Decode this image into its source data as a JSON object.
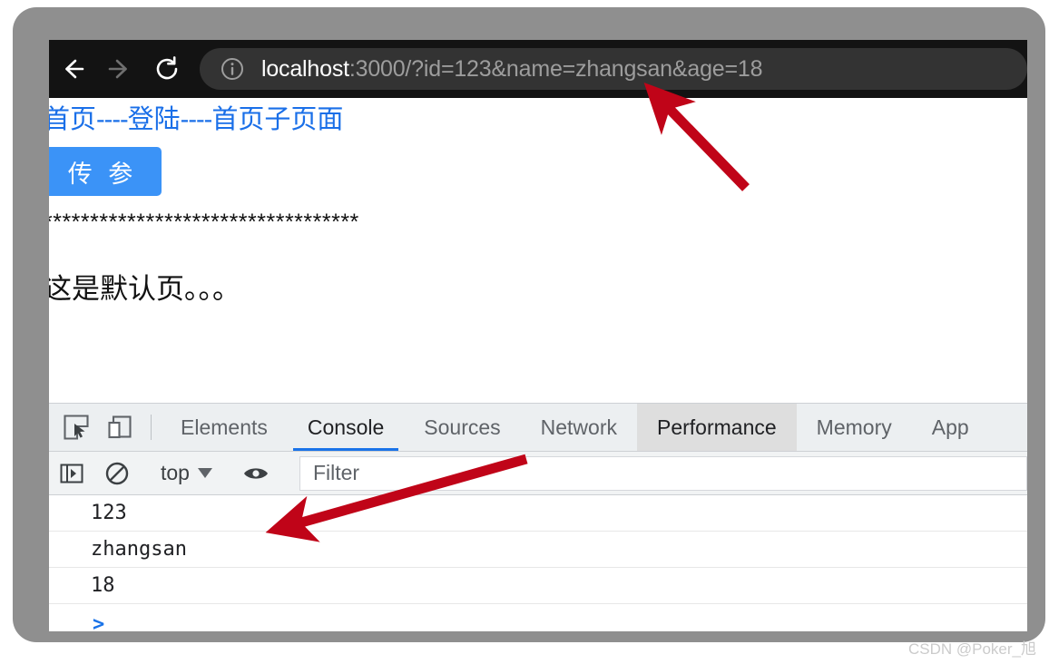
{
  "browser": {
    "back_label": "back-arrow",
    "forward_label": "forward-arrow",
    "reload_label": "reload",
    "url_host": "localhost",
    "url_rest": ":3000/?id=123&name=zhangsan&age=18",
    "url_full": "localhost:3000/?id=123&name=zhangsan&age=18",
    "site_info_icon": "info-circle-icon"
  },
  "page": {
    "links": [
      {
        "label": "首页"
      },
      {
        "label": "登陆"
      },
      {
        "label": "首页子页面"
      }
    ],
    "separator": "----",
    "button_label": "传 参",
    "divider_stars": "**********************************",
    "body_text": "这是默认页。。。"
  },
  "devtools": {
    "inspect_icon": "inspect-element-icon",
    "device_toggle_icon": "device-toolbar-icon",
    "tabs": [
      {
        "label": "Elements",
        "state": "normal"
      },
      {
        "label": "Console",
        "state": "active"
      },
      {
        "label": "Sources",
        "state": "normal"
      },
      {
        "label": "Network",
        "state": "normal"
      },
      {
        "label": "Performance",
        "state": "hovered"
      },
      {
        "label": "Memory",
        "state": "normal"
      },
      {
        "label": "App",
        "state": "clipped"
      }
    ],
    "console_toolbar": {
      "sidebar_icon": "console-sidebar-icon",
      "clear_icon": "clear-console-icon",
      "context_label": "top",
      "eye_icon": "live-expression-eye-icon",
      "filter_placeholder": "Filter",
      "filter_value": ""
    },
    "console_rows": [
      {
        "text": "123"
      },
      {
        "text": "zhangsan"
      },
      {
        "text": "18"
      }
    ],
    "prompt_symbol": ">"
  },
  "annotations": {
    "arrow_color": "#c00418",
    "arrow_url_target": "url-bar",
    "arrow_console_target": "console-row-zhangsan"
  },
  "watermark": {
    "text": "CSDN @Poker_旭"
  },
  "colors": {
    "toolbar_bg": "#131313",
    "omnibox_bg": "#333333",
    "link_blue": "#1a6fe8",
    "button_blue": "#3b93f7",
    "tab_active_underline": "#1a73e8",
    "frame_gray": "#8f8f8f",
    "arrow_red": "#c00418"
  }
}
